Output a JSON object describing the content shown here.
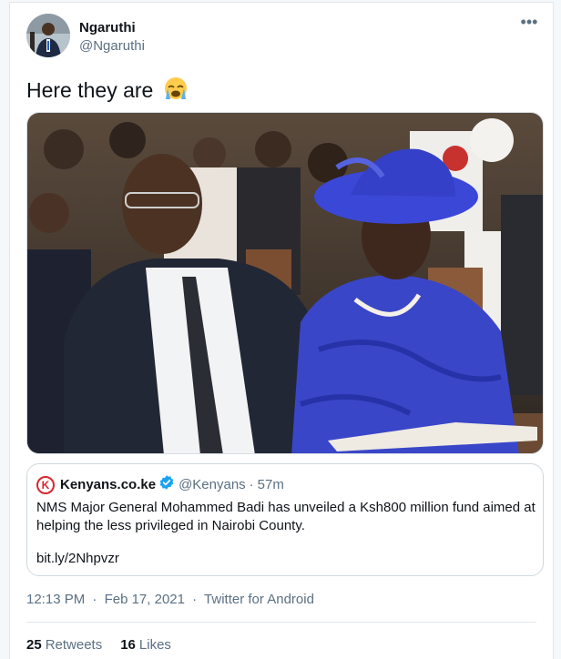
{
  "author": {
    "display_name": "Ngaruthi",
    "handle": "@Ngaruthi"
  },
  "tweet": {
    "text": "Here they are",
    "emoji": "loudly-crying-face-icon"
  },
  "photo": {
    "description_icon": "photo-icon"
  },
  "quoted_tweet": {
    "logo": "kenyans-logo-icon",
    "logo_letter": "K",
    "name": "Kenyans.co.ke",
    "verified_icon": "verified-badge-icon",
    "handle": "@Kenyans",
    "separator": "·",
    "time": "57m",
    "text": "NMS Major General Mohammed Badi has unveiled a Ksh800 million fund aimed at helping the less privileged in Nairobi County.",
    "link": "bit.ly/2Nhpvzr"
  },
  "meta": {
    "time": "12:13 PM",
    "separator": "·",
    "date": "Feb 17, 2021",
    "source": "Twitter for Android"
  },
  "stats": {
    "retweets_count": "25",
    "retweets_label": "Retweets",
    "likes_count": "16",
    "likes_label": "Likes"
  },
  "colors": {
    "link_blue": "#1da1f2",
    "muted_text": "#5b7083",
    "hat_blue": "#3b47d6",
    "brand_red": "#d7262f"
  }
}
